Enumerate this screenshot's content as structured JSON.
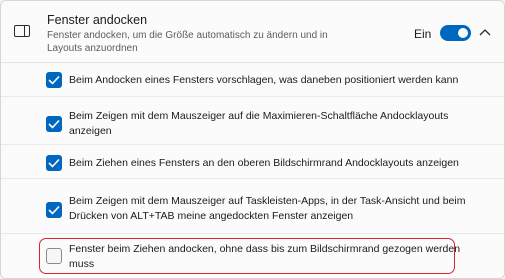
{
  "header": {
    "title": "Fenster andocken",
    "subtitle": "Fenster andocken, um die Größe automatisch zu ändern und in Layouts anzuordnen",
    "toggle_state_label": "Ein",
    "toggle_on": true,
    "icons": {
      "section": "snap-window-icon",
      "expand": "chevron-up-icon"
    }
  },
  "options": [
    {
      "label": "Beim Andocken eines Fensters vorschlagen, was daneben positioniert werden kann",
      "checked": true
    },
    {
      "label": "Beim Zeigen mit dem Mauszeiger auf die Maximieren-Schaltfläche Andocklayouts anzeigen",
      "checked": true
    },
    {
      "label": "Beim Ziehen eines Fensters an den oberen Bildschirmrand Andocklayouts anzeigen",
      "checked": true
    },
    {
      "label": "Beim Zeigen mit dem Mauszeiger auf Taskleisten-Apps, in der Task-Ansicht und beim Drücken von ALT+TAB meine angedockten Fenster anzeigen",
      "checked": true
    },
    {
      "label": "Fenster beim Ziehen andocken, ohne dass bis zum Bildschirmrand gezogen werden muss",
      "checked": false
    }
  ],
  "colors": {
    "accent": "#0067c0",
    "highlight": "#d9262d"
  }
}
